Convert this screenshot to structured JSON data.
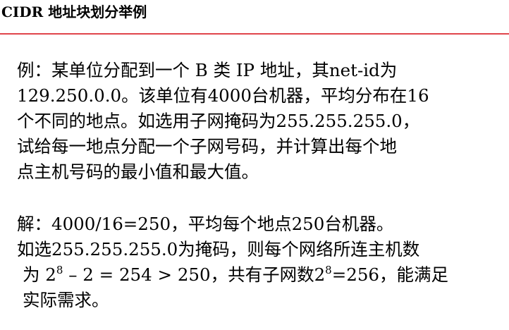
{
  "title": "CIDR 地址块划分举例",
  "colors": {
    "rule": "#e0454b",
    "text": "#000000"
  },
  "example": {
    "lines": [
      "例：某单位分配到一个 B 类 IP 地址，其net-id为",
      "129.250.0.0。该单位有4000台机器，平均分布在16",
      "个不同的地点。如选用子网掩码为255.255.255.0，",
      "试给每一地点分配一个子网号码，并计算出每个地",
      "点主机号码的最小值和最大值。"
    ]
  },
  "solution": {
    "line1": "解：4000/16=250，平均每个地点250台机器。",
    "line2": "如选255.255.255.0为掩码，则每个网络所连主机数",
    "line3": {
      "prefix": "为 2",
      "sup1": "8",
      "middle": " – 2 = 254 > 250，共有子网数2",
      "sup2": "8",
      "suffix": "=256，能满足"
    },
    "line4": "实际需求。"
  }
}
